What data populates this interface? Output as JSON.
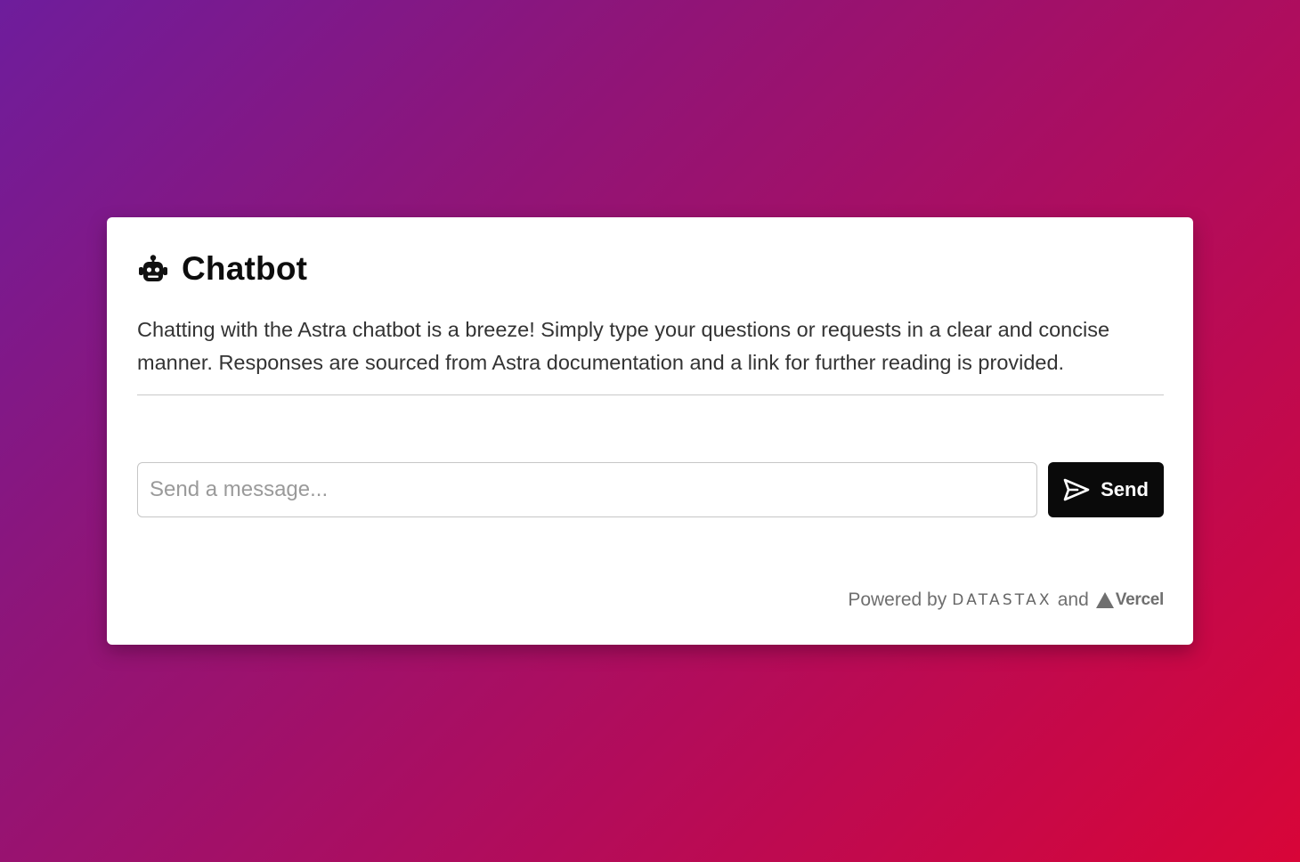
{
  "header": {
    "title": "Chatbot",
    "icon": "robot-icon"
  },
  "description": "Chatting with the Astra chatbot is a breeze! Simply type your questions or requests in a clear and concise manner. Responses are sourced from Astra documentation and a link for further reading is provided.",
  "composer": {
    "placeholder": "Send a message...",
    "value": "",
    "send_label": "Send",
    "send_icon": "paper-plane-icon"
  },
  "footer": {
    "powered_by": "Powered by",
    "brand_1": "DATASTAX",
    "conjunction": "and",
    "brand_2": "Vercel"
  },
  "colors": {
    "gradient_start": "#6e1d9c",
    "gradient_end": "#d80538",
    "card_background": "#ffffff",
    "button_background": "#0a0a0a"
  }
}
